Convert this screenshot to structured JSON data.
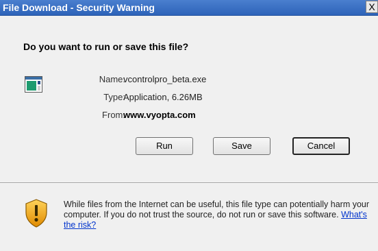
{
  "window": {
    "title": "File Download - Security Warning",
    "close_glyph": "X"
  },
  "dialog": {
    "question": "Do you want to run or save this file?",
    "file": {
      "name_label": "Name:",
      "name_value": "vcontrolpro_beta.exe",
      "type_label": "Type:",
      "type_value": "Application, 6.26MB",
      "from_label": "From:",
      "from_value": "www.vyopta.com"
    },
    "buttons": {
      "run": "Run",
      "save": "Save",
      "cancel": "Cancel"
    },
    "warning": {
      "text": "While files from the Internet can be useful, this file type can potentially harm your computer. If you do not trust the source, do not run or save this software.",
      "link": "What's the risk?"
    }
  },
  "icons": {
    "app": "application-file-icon",
    "shield": "security-warning-shield-icon"
  },
  "colors": {
    "titlebar": "#2d63b9",
    "dialog_bg": "#f0f0f0",
    "link": "#0033cc",
    "shield_orange": "#f2a000"
  }
}
